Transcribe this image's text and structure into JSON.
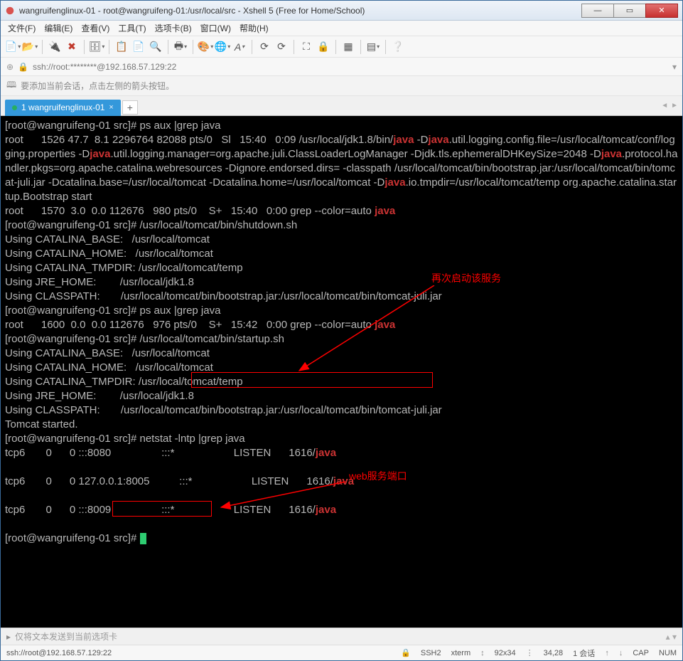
{
  "window": {
    "title": "wangruifenglinux-01 - root@wangruifeng-01:/usr/local/src - Xshell 5 (Free for Home/School)"
  },
  "menu": {
    "file": "文件(F)",
    "edit": "编辑(E)",
    "view": "查看(V)",
    "tools": "工具(T)",
    "tab": "选项卡(B)",
    "window": "窗口(W)",
    "help": "帮助(H)"
  },
  "address": "ssh://root:********@192.168.57.129:22",
  "hint": "要添加当前会话，点击左侧的箭头按钮。",
  "tabs": {
    "active": "1 wangruifenglinux-01"
  },
  "annotations": {
    "restart": "再次启动该服务",
    "webport": "web服务端口"
  },
  "sendbar": "仅将文本发送到当前选项卡",
  "status": {
    "conn": "ssh://root@192.168.57.129:22",
    "proto": "SSH2",
    "term": "xterm",
    "size": "92x34",
    "pos": "34,28",
    "sess": "1 会话",
    "cap": "CAP",
    "num": "NUM"
  },
  "terminal_lines": [
    {
      "t": "prompt",
      "user": "root",
      "host": "wangruifeng-01",
      "dir": "src",
      "cmd": "ps aux |grep java"
    },
    {
      "t": "raw",
      "parts": [
        {
          "s": "root      1526 47.7  8.1 2296764 82088 pts/0   Sl   15:40   0:09 /usr/local/jdk1.8/bin/"
        },
        {
          "s": "java",
          "c": "hl"
        },
        {
          "s": " -D"
        },
        {
          "s": "java",
          "c": "hl"
        },
        {
          "s": ".util.logging.config.file=/usr/local/tomcat/conf/logging.properties -D"
        },
        {
          "s": "java",
          "c": "hl"
        },
        {
          "s": ".util.logging.manager=org.apache.juli.ClassLoaderLogManager -Djdk.tls.ephemeralDHKeySize=2048 -D"
        },
        {
          "s": "java",
          "c": "hl"
        },
        {
          "s": ".protocol.handler.pkgs=org.apache.catalina.webresources -Dignore.endorsed.dirs= -classpath /usr/local/tomcat/bin/bootstrap.jar:/usr/local/tomcat/bin/tomcat-juli.jar -Dcatalina.base=/usr/local/tomcat -Dcatalina.home=/usr/local/tomcat -D"
        },
        {
          "s": "java",
          "c": "hl"
        },
        {
          "s": ".io.tmpdir=/usr/local/tomcat/temp org.apache.catalina.startup.Bootstrap start"
        }
      ]
    },
    {
      "t": "raw",
      "parts": [
        {
          "s": "root      1570  3.0  0.0 112676   980 pts/0    S+   15:40   0:00 grep --color=auto "
        },
        {
          "s": "java",
          "c": "hl"
        }
      ]
    },
    {
      "t": "prompt",
      "user": "root",
      "host": "wangruifeng-01",
      "dir": "src",
      "cmd": "/usr/local/tomcat/bin/shutdown.sh"
    },
    {
      "t": "plain",
      "s": "Using CATALINA_BASE:   /usr/local/tomcat"
    },
    {
      "t": "plain",
      "s": "Using CATALINA_HOME:   /usr/local/tomcat"
    },
    {
      "t": "plain",
      "s": "Using CATALINA_TMPDIR: /usr/local/tomcat/temp"
    },
    {
      "t": "plain",
      "s": "Using JRE_HOME:        /usr/local/jdk1.8"
    },
    {
      "t": "plain",
      "s": "Using CLASSPATH:       /usr/local/tomcat/bin/bootstrap.jar:/usr/local/tomcat/bin/tomcat-juli.jar"
    },
    {
      "t": "prompt",
      "user": "root",
      "host": "wangruifeng-01",
      "dir": "src",
      "cmd": "ps aux |grep java"
    },
    {
      "t": "raw",
      "parts": [
        {
          "s": "root      1600  0.0  0.0 112676   976 pts/0    S+   15:42   0:00 grep --color=auto "
        },
        {
          "s": "java",
          "c": "hl"
        }
      ]
    },
    {
      "t": "prompt",
      "user": "root",
      "host": "wangruifeng-01",
      "dir": "src",
      "cmd": "/usr/local/tomcat/bin/startup.sh"
    },
    {
      "t": "plain",
      "s": "Using CATALINA_BASE:   /usr/local/tomcat"
    },
    {
      "t": "plain",
      "s": "Using CATALINA_HOME:   /usr/local/tomcat"
    },
    {
      "t": "plain",
      "s": "Using CATALINA_TMPDIR: /usr/local/tomcat/temp"
    },
    {
      "t": "plain",
      "s": "Using JRE_HOME:        /usr/local/jdk1.8"
    },
    {
      "t": "plain",
      "s": "Using CLASSPATH:       /usr/local/tomcat/bin/bootstrap.jar:/usr/local/tomcat/bin/tomcat-juli.jar"
    },
    {
      "t": "plain",
      "s": "Tomcat started."
    },
    {
      "t": "prompt",
      "user": "root",
      "host": "wangruifeng-01",
      "dir": "src",
      "cmd": "netstat -lntp |grep java"
    },
    {
      "t": "raw",
      "parts": [
        {
          "s": "tcp6       0      0 :::8080                 :::*                    LISTEN      1616/"
        },
        {
          "s": "java",
          "c": "hl"
        }
      ]
    },
    {
      "t": "plain",
      "s": ""
    },
    {
      "t": "raw",
      "parts": [
        {
          "s": "tcp6       0      0 127.0.0.1:8005          :::*                    LISTEN      1616/"
        },
        {
          "s": "java",
          "c": "hl"
        }
      ]
    },
    {
      "t": "plain",
      "s": ""
    },
    {
      "t": "raw",
      "parts": [
        {
          "s": "tcp6       0      0 :::8009                 :::*                    LISTEN      1616/"
        },
        {
          "s": "java",
          "c": "hl"
        }
      ]
    },
    {
      "t": "plain",
      "s": ""
    },
    {
      "t": "prompt",
      "user": "root",
      "host": "wangruifeng-01",
      "dir": "src",
      "cmd": "",
      "cursor": true
    }
  ]
}
